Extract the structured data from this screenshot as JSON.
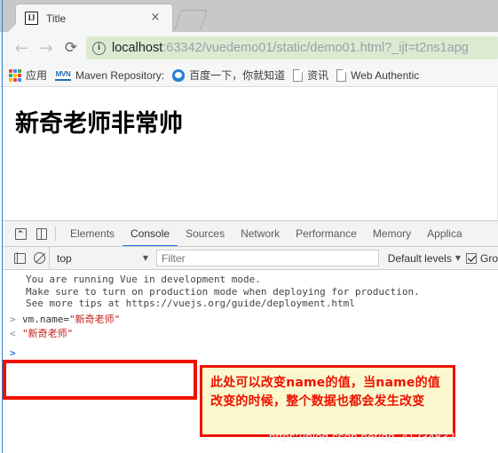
{
  "browser": {
    "tab": {
      "title": "Title",
      "favicon_name": "intellij-idea-icon",
      "favicon_text": "IJ",
      "close_label": "×"
    },
    "new_tab_label": "",
    "nav": {
      "back_label": "←",
      "forward_label": "→",
      "reload_label": "⟳"
    },
    "omnibox": {
      "info_label": "i",
      "host": "localhost",
      "rest": ":63342/vuedemo01/static/demo01.html?_ijt=t2ns1apg",
      "full_url": "localhost:63342/vuedemo01/static/demo01.html?_ijt=t2ns1apg"
    },
    "bookmarks": [
      {
        "label": "应用",
        "icon": "apps-grid-icon"
      },
      {
        "label": "Maven Repository:",
        "icon": "maven-icon",
        "icon_text": "MVN"
      },
      {
        "label": "百度一下，你就知道",
        "icon": "baidu-icon"
      },
      {
        "label": "资讯",
        "icon": "page-icon"
      },
      {
        "label": "Web Authentic",
        "icon": "page-icon"
      }
    ]
  },
  "page": {
    "heading": "新奇老师非常帅"
  },
  "devtools": {
    "icons": {
      "inspect": "inspect-element-icon",
      "device": "device-toolbar-icon"
    },
    "tabs": [
      {
        "label": "Elements",
        "active": false
      },
      {
        "label": "Console",
        "active": true
      },
      {
        "label": "Sources",
        "active": false
      },
      {
        "label": "Network",
        "active": false
      },
      {
        "label": "Performance",
        "active": false
      },
      {
        "label": "Memory",
        "active": false
      },
      {
        "label": "Applica",
        "active": false
      }
    ],
    "console_toolbar": {
      "sidebar_icon": "sidebar-toggle-icon",
      "clear_icon": "clear-console-icon",
      "context": "top",
      "context_caret": "▼",
      "filter_placeholder": "Filter",
      "levels_label": "Default levels",
      "levels_caret": "▼",
      "group_similar_label": "Gro",
      "group_similar_checked": true
    },
    "console": {
      "vue_messages": [
        "You are running Vue in development mode.",
        "Make sure to turn on production mode when deploying for production.",
        "See more tips at https://vuejs.org/guide/deployment.html"
      ],
      "vue_link_text": "https://vuejs.org/guide/deployment.html",
      "command_prompt": ">",
      "command_expr": "vm.name=",
      "command_value": "\"新奇老师\"",
      "output_prompt": "<",
      "output_value": "\"新奇老师\"",
      "input_prompt": ">"
    }
  },
  "annotations": {
    "callout_text": "此处可以改变name的值，当name的值改变的时候，整个数据也都会发生改变",
    "highlight_color": "#ee1100",
    "callout_bg": "#fbf8cd"
  },
  "watermark": "https://blog.csdn.net/qq_41234832"
}
